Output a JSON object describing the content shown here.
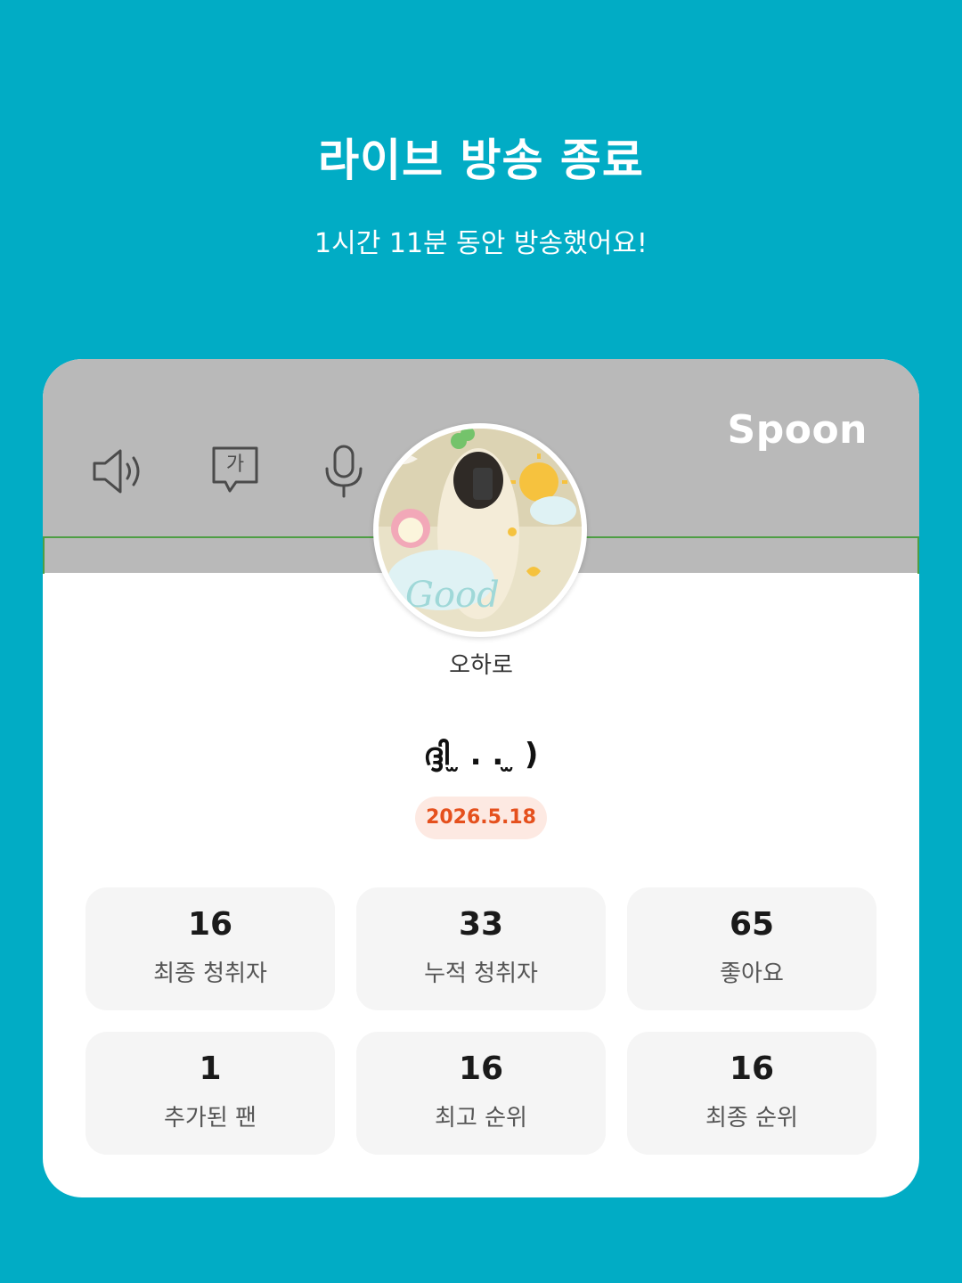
{
  "header": {
    "title": "라이브 방송 종료",
    "subtitle": "1시간 11분 동안 방송했어요!"
  },
  "card": {
    "brand": "Spoon",
    "icons": [
      "speaker-icon",
      "chat-icon",
      "mic-icon"
    ],
    "chat_icon_glyph": "가",
    "nickname": "오하로",
    "room_title": "ദ്ദി ̫ . . ̫ )",
    "date": "2026.5.18"
  },
  "stats": [
    {
      "value": "16",
      "label": "최종 청취자"
    },
    {
      "value": "33",
      "label": "누적 청취자"
    },
    {
      "value": "65",
      "label": "좋아요"
    },
    {
      "value": "1",
      "label": "추가된 팬"
    },
    {
      "value": "16",
      "label": "최고 순위"
    },
    {
      "value": "16",
      "label": "최종 순위"
    }
  ],
  "colors": {
    "background": "#01acc5",
    "header_gray": "#b9b9b9",
    "date_text": "#e5501d",
    "date_bg": "#fde9e2",
    "stat_bg": "#f5f5f5"
  }
}
